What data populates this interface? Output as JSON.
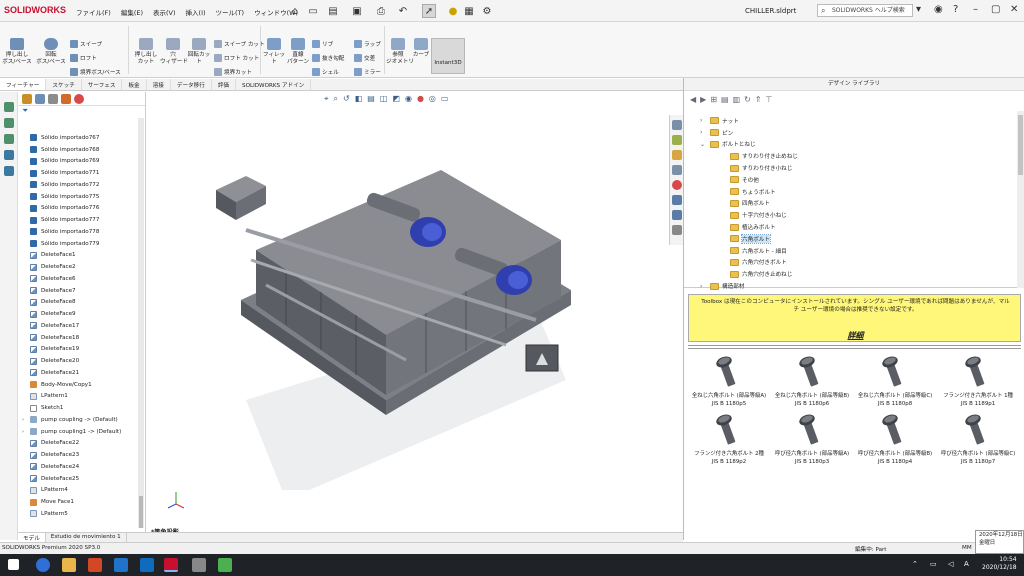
{
  "titlebar": {
    "app_name": "SOLIDWORKS",
    "menus": [
      "ファイル(F)",
      "編集(E)",
      "表示(V)",
      "挿入(I)",
      "ツール(T)",
      "ウィンドウ(W)"
    ],
    "document": "CHILLER.sldprt",
    "help_search_placeholder": "SOLIDWORKS ヘルプ検索"
  },
  "ribbon": {
    "extrude": "押し出し\nボス/ベース",
    "revolve": "回転\nボス/ベース",
    "sweep": "スイープ",
    "loft": "ロフト",
    "boundary": "境界ボス/ベース",
    "extrude_cut": "押し出し\nカット",
    "hole_wizard": "穴\nウィザード",
    "revolve_cut": "回転カット",
    "sweep_cut": "スイープ カット",
    "loft_cut": "ロフト カット",
    "boundary_cut": "境界カット",
    "fillet": "フィレット",
    "linear_pattern": "直線\nパターン",
    "rib": "リブ",
    "draft": "抜き勾配",
    "shell": "シェル",
    "wrap": "ラップ",
    "intersect": "交差",
    "mirror": "ミラー",
    "ref_geometry": "参照\nジオメトリ",
    "curves": "カーブ",
    "instant3d": "Instant3D"
  },
  "command_tabs": [
    "フィーチャー",
    "スケッチ",
    "サーフェス",
    "板金",
    "溶接",
    "データ移行",
    "評価",
    "SOLIDWORKS アドイン"
  ],
  "feature_tree": [
    {
      "label": "Sólido importado767",
      "icon": "solid"
    },
    {
      "label": "Sólido importado768",
      "icon": "solid"
    },
    {
      "label": "Sólido importado769",
      "icon": "solid"
    },
    {
      "label": "Sólido importado771",
      "icon": "solid"
    },
    {
      "label": "Sólido importado772",
      "icon": "solid"
    },
    {
      "label": "Sólido importado775",
      "icon": "solid"
    },
    {
      "label": "Sólido importado776",
      "icon": "solid"
    },
    {
      "label": "Sólido importado777",
      "icon": "solid"
    },
    {
      "label": "Sólido importado778",
      "icon": "solid"
    },
    {
      "label": "Sólido importado779",
      "icon": "solid"
    },
    {
      "label": "DeleteFace1",
      "icon": "del"
    },
    {
      "label": "DeleteFace2",
      "icon": "del"
    },
    {
      "label": "DeleteFace6",
      "icon": "del"
    },
    {
      "label": "DeleteFace7",
      "icon": "del"
    },
    {
      "label": "DeleteFace8",
      "icon": "del"
    },
    {
      "label": "DeleteFace9",
      "icon": "del"
    },
    {
      "label": "DeleteFace17",
      "icon": "del"
    },
    {
      "label": "DeleteFace18",
      "icon": "del"
    },
    {
      "label": "DeleteFace19",
      "icon": "del"
    },
    {
      "label": "DeleteFace20",
      "icon": "del"
    },
    {
      "label": "DeleteFace21",
      "icon": "del"
    },
    {
      "label": "Body-Move/Copy1",
      "icon": "move"
    },
    {
      "label": "LPattern1",
      "icon": "pat"
    },
    {
      "label": "Sketch1",
      "icon": "sketch"
    },
    {
      "label": "pump coupling -> (Default)",
      "icon": "asm",
      "expand": true
    },
    {
      "label": "pump coupling1 -> (Default)",
      "icon": "asm",
      "expand": true
    },
    {
      "label": "DeleteFace22",
      "icon": "del"
    },
    {
      "label": "DeleteFace23",
      "icon": "del"
    },
    {
      "label": "DeleteFace24",
      "icon": "del"
    },
    {
      "label": "DeleteFace25",
      "icon": "del"
    },
    {
      "label": "LPattern4",
      "icon": "pat"
    },
    {
      "label": "Move Face1",
      "icon": "move"
    },
    {
      "label": "LPattern5",
      "icon": "pat"
    }
  ],
  "bottom_tabs": [
    "モデル",
    "Estudio de movimiento 1"
  ],
  "viewport": {
    "view_label": "*等角投影"
  },
  "taskpane": {
    "title": "デザイン ライブラリ",
    "tree": [
      {
        "label": "ナット",
        "indent": 1,
        "arrow": "›"
      },
      {
        "label": "ピン",
        "indent": 1,
        "arrow": "›"
      },
      {
        "label": "ボルトとねじ",
        "indent": 1,
        "arrow": "⌄"
      },
      {
        "label": "すりわり付き止めねじ",
        "indent": 2
      },
      {
        "label": "すりわり付き小ねじ",
        "indent": 2
      },
      {
        "label": "その他",
        "indent": 2
      },
      {
        "label": "ちょうボルト",
        "indent": 2
      },
      {
        "label": "四角ボルト",
        "indent": 2
      },
      {
        "label": "十字穴付き小ねじ",
        "indent": 2
      },
      {
        "label": "植込みボルト",
        "indent": 2
      },
      {
        "label": "六角ボルト",
        "indent": 2,
        "selected": true
      },
      {
        "label": "六角ボルト - 細目",
        "indent": 2
      },
      {
        "label": "六角穴付きボルト",
        "indent": 2
      },
      {
        "label": "六角穴付き止めねじ",
        "indent": 2
      },
      {
        "label": "構造部材",
        "indent": 1,
        "arrow": "›"
      }
    ],
    "notice": "Toolbox は現在このコンピュータにインストールされています。シングル ユーザー環境であれば問題はありませんが、マルチ ユーザー環境の場合は推奨できない設定です。",
    "notice_details": "詳細",
    "parts": [
      "全ねじ六角ボルト (部品等級A) JIS B 1180p5",
      "全ねじ六角ボルト (部品等級B) JIS B 1180p6",
      "全ねじ六角ボルト (部品等級C) JIS B 1180p8",
      "フランジ付き六角ボルト 1種 JIS B 1189p1",
      "フランジ付き六角ボルト 2種 JIS B 1189p2",
      "呼び径六角ボルト (部品等級A) JIS B 1180p3",
      "呼び径六角ボルト (部品等級B) JIS B 1180p4",
      "呼び径六角ボルト (部品等級C) JIS B 1180p7"
    ]
  },
  "statusbar": {
    "product": "SOLIDWORKS Premium 2020 SP3.0",
    "mode": "編集中: Part",
    "units": "MM"
  },
  "tooltip": {
    "date": "2020年12月18日",
    "weekday": "金曜日"
  },
  "taskbar_clock": {
    "time": "10:54",
    "date": "2020/12/18"
  }
}
